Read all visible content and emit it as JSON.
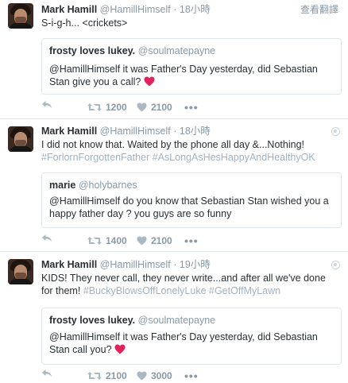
{
  "tweets": [
    {
      "author_name": "Mark Hamill",
      "author_handle": "@HamillHimself",
      "separator": "·",
      "time": "18小時",
      "translate_label": "查看翻譯",
      "text": "S-i-g-h... <crickets>",
      "hashtags": "",
      "quote": {
        "name": "frosty loves lukey.",
        "handle": "@soulmatepayne",
        "text": "@HamillHimself it was Father's Day yesterday, did Sebastian Stan give you a call?",
        "emoji": "heart"
      },
      "retweets": "1200",
      "likes": "2100",
      "more_label": "•••"
    },
    {
      "author_name": "Mark Hamill",
      "author_handle": "@HamillHimself",
      "separator": "·",
      "time": "18小時",
      "text": "I did not know that. Waited by the phone all day &...Nothing!",
      "hashtags": "#ForlornForgottenFather #AsLongAsHesHappyAndHealthyOK",
      "quote": {
        "name": "marie",
        "handle": "@holybarnes",
        "text": "@HamillHimself do you know that Sebastian Stan wished you a happy father day ? you guys are so funny"
      },
      "retweets": "1400",
      "likes": "2100",
      "more_label": "•••"
    },
    {
      "author_name": "Mark Hamill",
      "author_handle": "@HamillHimself",
      "separator": "·",
      "time": "19小時",
      "text": "KIDS! They never call, they never write...and after all we've done for them!",
      "hashtags": "#BuckyBlowsOffLonelyLuke #GetOffMyLawn",
      "quote": {
        "name": "frosty loves lukey.",
        "handle": "@soulmatepayne",
        "text": "@HamillHimself it was Father's Day yesterday, did Sebastian Stan call you?",
        "emoji": "heart"
      },
      "retweets": "2100",
      "likes": "3000",
      "more_label": "•••"
    }
  ],
  "colors": {
    "text": "#292f33",
    "muted": "#8899a6",
    "icon": "#aab8c2",
    "hashtag": "#9fb3c6",
    "border": "#e1e8ed",
    "heart_emoji": "#e0245e"
  },
  "icons": [
    "reply-icon",
    "retweet-icon",
    "like-icon",
    "more-icon",
    "globe-icon",
    "heart-emoji-icon"
  ]
}
